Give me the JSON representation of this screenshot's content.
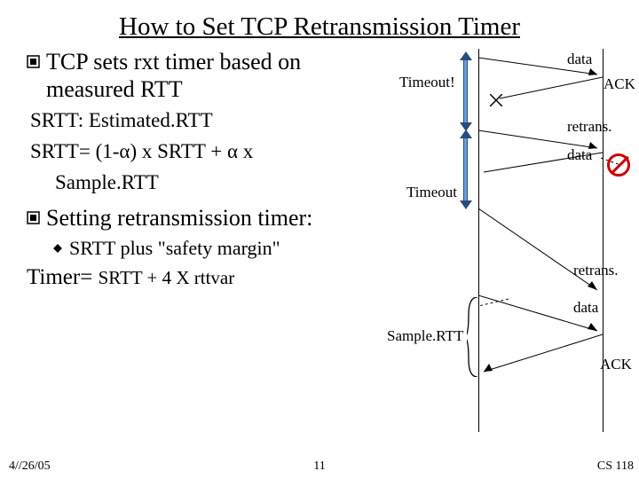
{
  "title": "How to Set TCP Retransmission Timer",
  "bullets": {
    "b1": "TCP sets rxt timer based on measured RTT",
    "srtt1": "SRTT: Estimated.RTT",
    "srtt2": "SRTT= (1-α) x SRTT + α x",
    "srtt2b": "Sample.RTT",
    "b2": "Setting retransmission timer:",
    "sub1": "SRTT plus \"safety margin\""
  },
  "timer_eq_prefix": "Timer= ",
  "timer_eq_suffix": "SRTT + 4 X rttvar",
  "diagram": {
    "timeout_bang": "Timeout!",
    "timeout": "Timeout",
    "data": "data",
    "ack": "ACK",
    "retrans": "retrans.",
    "sample_rtt": "Sample.RTT"
  },
  "footer": {
    "date": "4//26/05",
    "page": "11",
    "course": "CS 118"
  }
}
